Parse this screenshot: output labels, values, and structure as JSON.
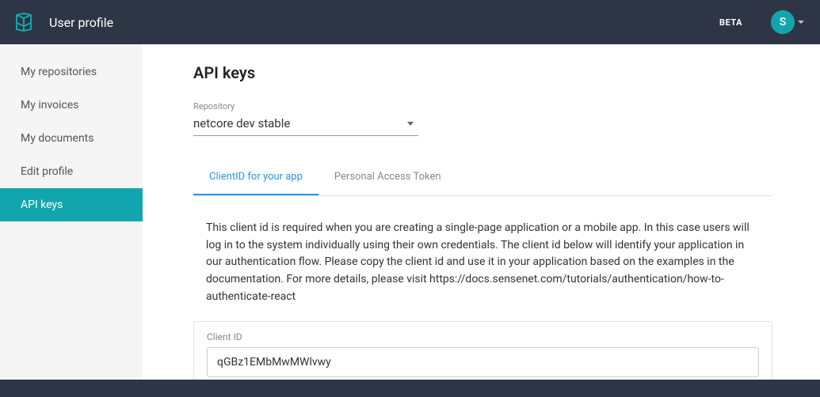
{
  "header": {
    "title": "User profile",
    "beta_label": "BETA",
    "avatar_initial": "S"
  },
  "sidebar": {
    "items": [
      {
        "label": "My repositories",
        "active": false
      },
      {
        "label": "My invoices",
        "active": false
      },
      {
        "label": "My documents",
        "active": false
      },
      {
        "label": "Edit profile",
        "active": false
      },
      {
        "label": "API keys",
        "active": true
      }
    ]
  },
  "main": {
    "title": "API keys",
    "repo_select": {
      "label": "Repository",
      "value": "netcore dev stable"
    },
    "tabs": [
      {
        "label": "ClientID for your app",
        "active": true
      },
      {
        "label": "Personal Access Token",
        "active": false
      }
    ],
    "description": "This client id is required when you are creating a single-page application or a mobile app. In this case users will log in to the system individually using their own credentials. The client id below will identify your application in our authentication flow. Please copy the client id and use it in your application based on the examples in the documentation. For more details, please visit https://docs.sensenet.com/tutorials/authentication/how-to-authenticate-react",
    "client_id_label": "Client ID",
    "client_id_value": "qGBz1EMbMwMWlvwy"
  }
}
